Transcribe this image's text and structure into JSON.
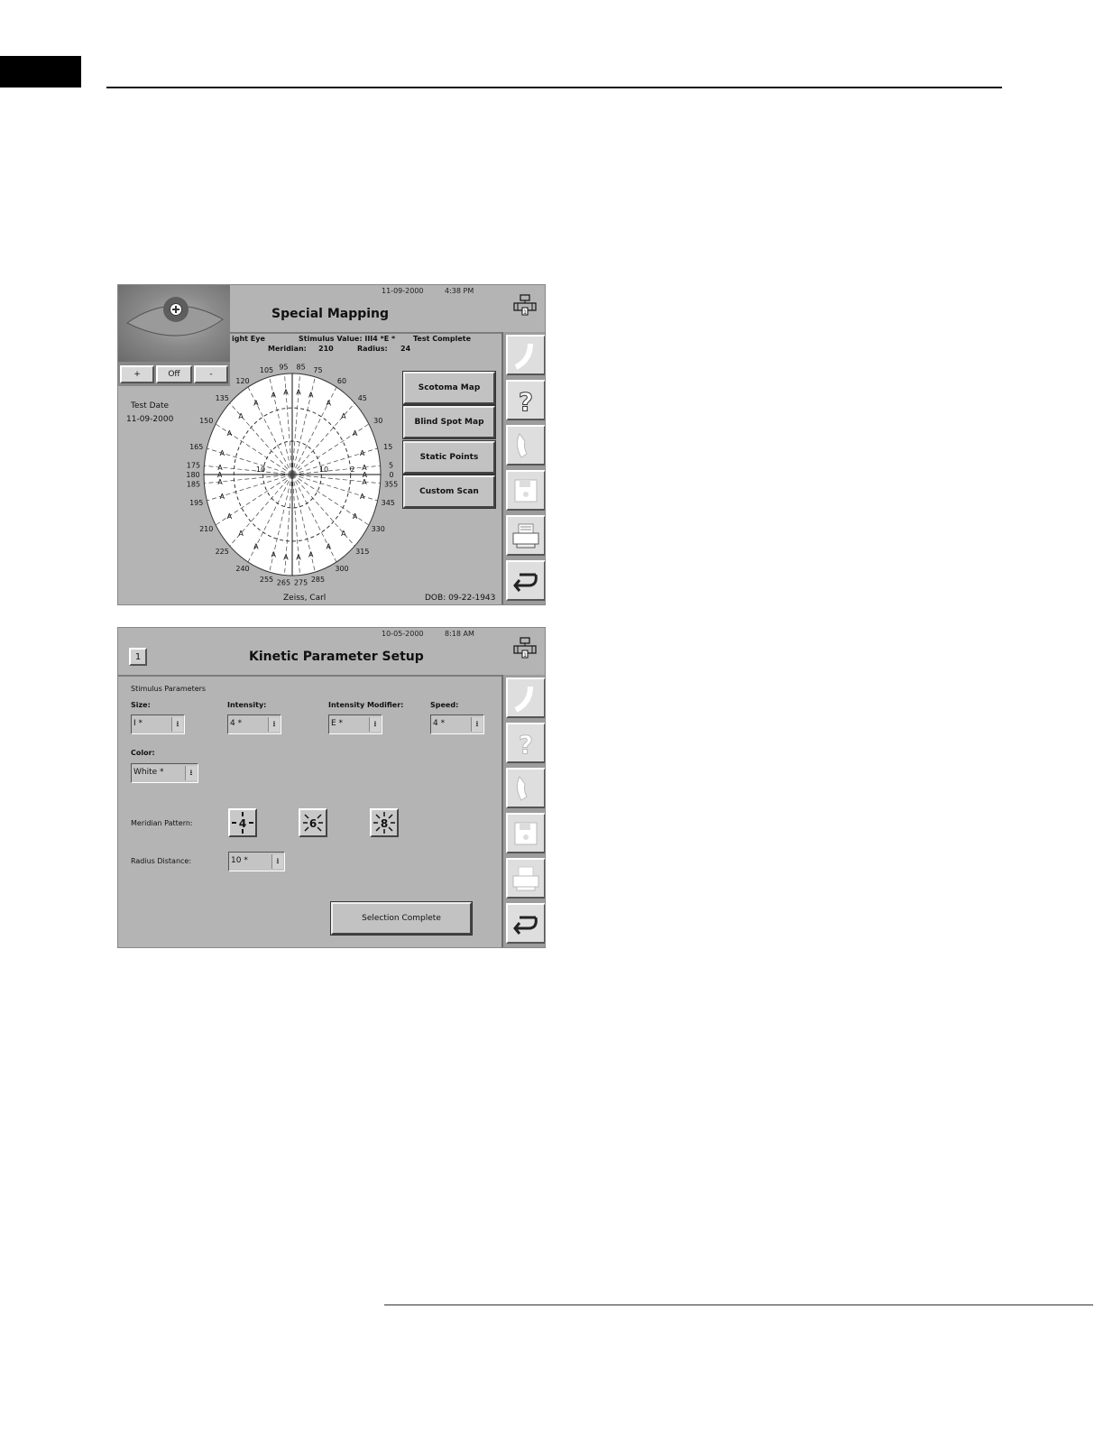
{
  "screen1": {
    "date": "11-09-2000",
    "time": "4:38 PM",
    "title": "Special Mapping",
    "eye_controls": {
      "plus": "+",
      "off": "Off",
      "minus": "-"
    },
    "eye_label": "ight Eye",
    "stimulus_value": "Stimulus Value:  III4 *E *",
    "status": "Test Complete",
    "meridian_label": "Meridian:",
    "meridian_value": "210",
    "radius_label": "Radius:",
    "radius_value": "24",
    "test_date_label": "Test Date",
    "test_date_value": "11-09-2000",
    "patient_name": "Zeiss, Carl",
    "dob": "DOB: 09-22-1943",
    "buttons": [
      "Scotoma Map",
      "Blind Spot Map",
      "Static Points",
      "Custom Scan"
    ],
    "meridians": [
      "95",
      "85",
      "75",
      "105",
      "120",
      "60",
      "45",
      "135",
      "150",
      "30",
      "165",
      "15",
      "175",
      "5",
      "180",
      "0",
      "185",
      "355",
      "195",
      "345",
      "210",
      "330",
      "225",
      "315",
      "240",
      "300",
      "255",
      "285",
      "265",
      "275"
    ],
    "ring_labels": [
      "10",
      "10",
      "2"
    ],
    "mark": "A"
  },
  "screen2": {
    "date": "10-05-2000",
    "time": "8:18 AM",
    "title": "Kinetic Parameter Setup",
    "back_glyph": "1",
    "section_label": "Stimulus Parameters",
    "size_label": "Size:",
    "size_value": "I *",
    "intensity_label": "Intensity:",
    "intensity_value": "4 *",
    "modifier_label": "Intensity Modifier:",
    "modifier_value": "E *",
    "speed_label": "Speed:",
    "speed_value": "4 *",
    "color_label": "Color:",
    "color_value": "White  *",
    "meridian_pattern_label": "Meridian Pattern:",
    "meridian_patterns": [
      "4",
      "6",
      "8"
    ],
    "radius_label": "Radius Distance:",
    "radius_value": "10 *",
    "selection_button": "Selection Complete"
  },
  "icons": {
    "network": "network-icon",
    "sidebar": [
      "blank-curve-icon",
      "help-icon",
      "phone-icon",
      "save-disk-icon",
      "print-icon",
      "return-arrow-icon"
    ]
  },
  "colors": {
    "screen_bg": "#b4b4b4",
    "sidebar_bg": "#9c9c9c",
    "plot_bg": "#ffffff"
  }
}
